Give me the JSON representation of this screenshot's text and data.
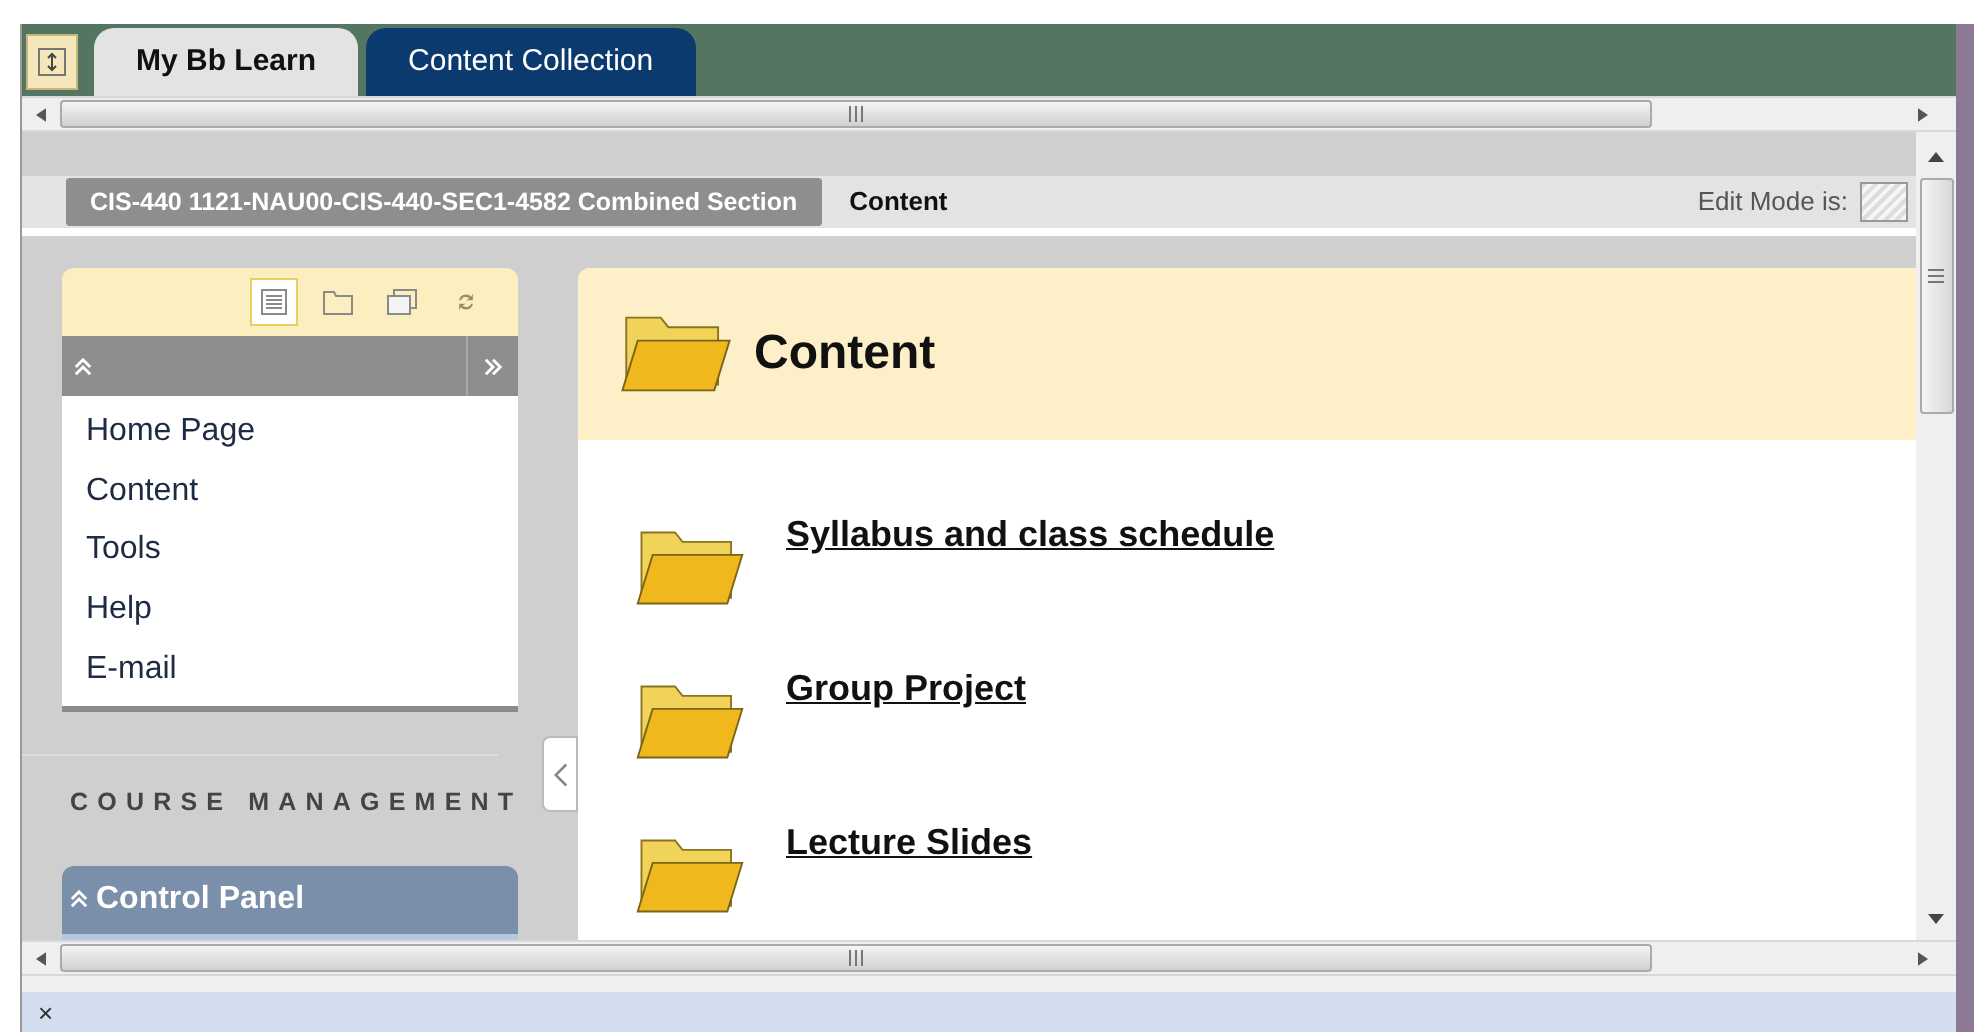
{
  "tabs": [
    {
      "label": "My Bb Learn",
      "selected": true
    },
    {
      "label": "Content Collection",
      "selected": false
    }
  ],
  "breadcrumb": {
    "course": "CIS-440 1121-NAU00-CIS-440-SEC1-4582 Combined Section",
    "page": "Content",
    "edit_mode_label": "Edit Mode is:"
  },
  "course_menu": {
    "view_buttons": [
      {
        "kind": "list",
        "selected": true
      },
      {
        "kind": "folder",
        "selected": false
      },
      {
        "kind": "window",
        "selected": false
      },
      {
        "kind": "refresh",
        "selected": false
      }
    ],
    "items": [
      "Home Page",
      "Content",
      "Tools",
      "Help",
      "E-mail"
    ]
  },
  "course_management": {
    "heading": "COURSE MANAGEMENT",
    "panel_title": "Control Panel"
  },
  "content": {
    "title": "Content",
    "items": [
      "Syllabus and class schedule",
      "Group Project",
      "Lecture Slides"
    ]
  },
  "status_bar": {
    "close": "×"
  }
}
